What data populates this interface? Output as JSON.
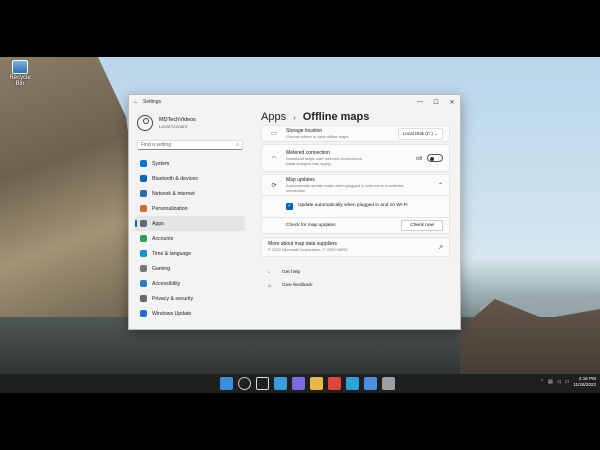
{
  "desktop": {
    "icon_label": "Recycle Bin"
  },
  "window": {
    "title": "Settings",
    "controls": {
      "minimize": "—",
      "maximize": "☐",
      "close": "✕"
    }
  },
  "profile": {
    "name": "MDTechVideos",
    "subtitle": "Local Account"
  },
  "search": {
    "placeholder": "Find a setting"
  },
  "sidebar": {
    "items": [
      {
        "label": "System",
        "color": "#0078d4"
      },
      {
        "label": "Bluetooth & devices",
        "color": "#0067c0"
      },
      {
        "label": "Network & internet",
        "color": "#2b6cb0"
      },
      {
        "label": "Personalization",
        "color": "#c9702d"
      },
      {
        "label": "Apps",
        "color": "#5a6b7a",
        "active": true
      },
      {
        "label": "Accounts",
        "color": "#2e9e5b"
      },
      {
        "label": "Time & language",
        "color": "#1e8fcf"
      },
      {
        "label": "Gaming",
        "color": "#777"
      },
      {
        "label": "Accessibility",
        "color": "#2a7bd1"
      },
      {
        "label": "Privacy & security",
        "color": "#666"
      },
      {
        "label": "Windows Update",
        "color": "#1f6fd1"
      }
    ]
  },
  "breadcrumb": {
    "parent": "Apps",
    "separator": "›",
    "current": "Offline maps"
  },
  "settings": {
    "storage": {
      "title": "Storage location",
      "desc": "Choose where to save offline maps",
      "value": "Local Disk (C:)"
    },
    "metered": {
      "title": "Metered connection",
      "desc": "Download maps over metered connections (data charges may apply)",
      "state": "Off"
    },
    "updates": {
      "title": "Map updates",
      "desc": "Automatically update maps when plugged in and not on a metered connection"
    },
    "auto_update": {
      "label": "Update automatically when plugged in and on Wi-Fi"
    },
    "check": {
      "label": "Check for map updates",
      "button": "Check now"
    },
    "suppliers": {
      "title": "More about map data suppliers",
      "desc": "© 2022 Microsoft Corporation, © 2020 HERE"
    }
  },
  "help": {
    "get_help": "Get help",
    "feedback": "Give feedback"
  },
  "taskbar": {
    "icons": [
      {
        "name": "start-icon",
        "color": "#3a8fe0"
      },
      {
        "name": "search-icon",
        "color": "#cccccc"
      },
      {
        "name": "taskview-icon",
        "color": "#dddddd"
      },
      {
        "name": "widgets-icon",
        "color": "#3b9bd6"
      },
      {
        "name": "chat-icon",
        "color": "#7b6be0"
      },
      {
        "name": "explorer-icon",
        "color": "#e8b84a"
      },
      {
        "name": "chrome-icon",
        "color": "#e0463a"
      },
      {
        "name": "edge-icon",
        "color": "#2ea0d8"
      },
      {
        "name": "store-icon",
        "color": "#4a8fe0"
      },
      {
        "name": "settings-icon",
        "color": "#9aa0a6"
      }
    ],
    "time": "4:16 PM",
    "date": "11/26/2022"
  }
}
